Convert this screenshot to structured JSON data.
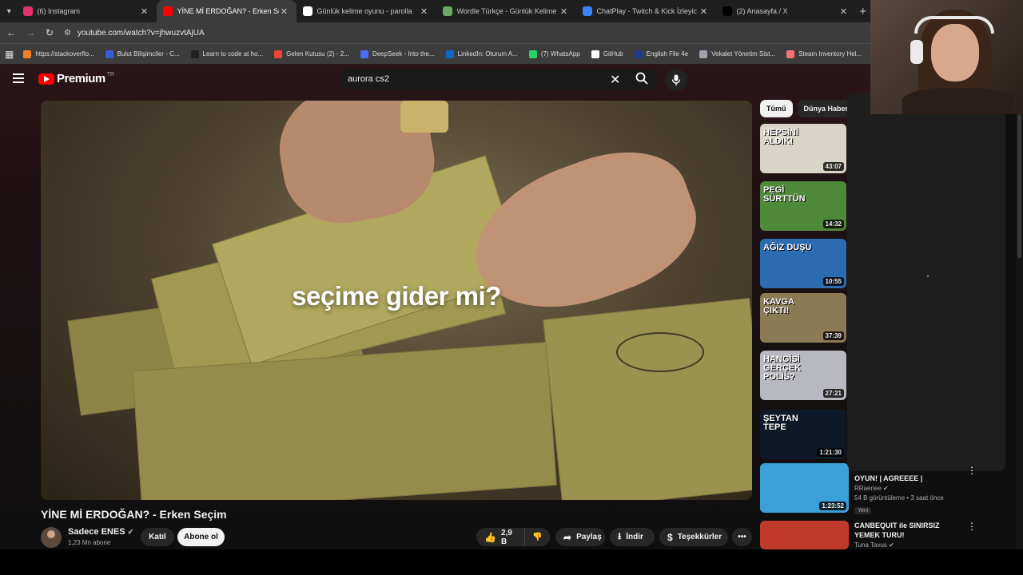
{
  "tabs": [
    {
      "title": "(6) Instagram",
      "favicon": "instagram-icon",
      "color": "#e1306c",
      "active": false
    },
    {
      "title": "YİNE Mİ ERDOĞAN? - Erken Seç",
      "favicon": "youtube-icon",
      "color": "#ff0000",
      "active": true
    },
    {
      "title": "Günlük kelime oyunu - parolla",
      "favicon": "globe-icon",
      "color": "#ffffff",
      "active": false
    },
    {
      "title": "Wordle Türkçe - Günlük Kelime",
      "favicon": "wordle-icon",
      "color": "#6aaa64",
      "active": false
    },
    {
      "title": "ChatPlay - Twitch & Kick İzleyic",
      "favicon": "chatplay-icon",
      "color": "#3b82f6",
      "active": false
    },
    {
      "title": "(2) Anasayfa / X",
      "favicon": "x-icon",
      "color": "#000000",
      "active": false
    }
  ],
  "url": "youtube.com/watch?v=jhwuzvtAjUA",
  "bookmarks": [
    {
      "label": "https://stackoverflo...",
      "color": "#f48024"
    },
    {
      "label": "Bulut Bilişimciler - C...",
      "color": "#3b5bdb"
    },
    {
      "label": "Learn to code at ho...",
      "color": "#222222"
    },
    {
      "label": "Gelen Kutusu (2) - 2...",
      "color": "#ea4335"
    },
    {
      "label": "DeepSeek - Into the...",
      "color": "#4d6bfe"
    },
    {
      "label": "LinkedIn: Oturum A...",
      "color": "#0a66c2"
    },
    {
      "label": "(7) WhatsApp",
      "color": "#25d366"
    },
    {
      "label": "GitHub",
      "color": "#ffffff"
    },
    {
      "label": "English File 4e",
      "color": "#1e3a8a"
    },
    {
      "label": "Vekalet Yönetim Sist...",
      "color": "#9ca3af"
    },
    {
      "label": "Steam Inventory Hel...",
      "color": "#f87171"
    }
  ],
  "youtube": {
    "logo_text": "Premium",
    "region": "TR",
    "search_query": "aurora cs2"
  },
  "video": {
    "overlay_text": "seçime gider mi?",
    "title": "YİNE Mİ ERDOĞAN? - Erken Seçim",
    "channel": "Sadece ENES",
    "subscribers": "1,23 Mn abone",
    "join_label": "Katıl",
    "subscribe_label": "Abone ol",
    "likes": "2,9 B",
    "share_label": "Paylaş",
    "download_label": "İndir",
    "thanks_label": "Teşekkürler"
  },
  "chips": [
    "Tümü",
    "Dünya Haberl"
  ],
  "recommended": [
    {
      "duration": "43:07",
      "thumb_text": "HEPSİNİ ALDIK!",
      "bg": "#d9d4c8"
    },
    {
      "duration": "14:32",
      "thumb_text": "PEGİ SÜRTTÜN",
      "bg": "#4f8a3a"
    },
    {
      "duration": "10:55",
      "thumb_text": "AĞIZ DUŞU",
      "bg": "#2b6cb0"
    },
    {
      "duration": "37:39",
      "thumb_text": "KAVGA ÇIKTI!",
      "bg": "#8a7a55"
    },
    {
      "duration": "27:21",
      "thumb_text": "HANGİSİ GERÇEK POLİS?",
      "bg": "#b8b8c0"
    },
    {
      "duration": "1:21:30",
      "thumb_text": "ŞEYTAN TEPE",
      "bg": "#0e1a2a"
    },
    {
      "duration": "1:23:52",
      "thumb_text": "",
      "bg": "#3aa0d8"
    },
    {
      "duration": "",
      "thumb_text": "",
      "bg": "#c0392b"
    }
  ],
  "side_items": [
    {
      "title": "OYUN! | AGREEEE |",
      "channel": "RRaenee",
      "meta": "54 B görüntüleme • 3 saat önce",
      "badge": "Yeni"
    },
    {
      "title": "CANBEQUIT ile SINIRSIZ YEMEK TURU!",
      "channel": "Tuna Tavus",
      "meta": "",
      "badge": ""
    }
  ]
}
